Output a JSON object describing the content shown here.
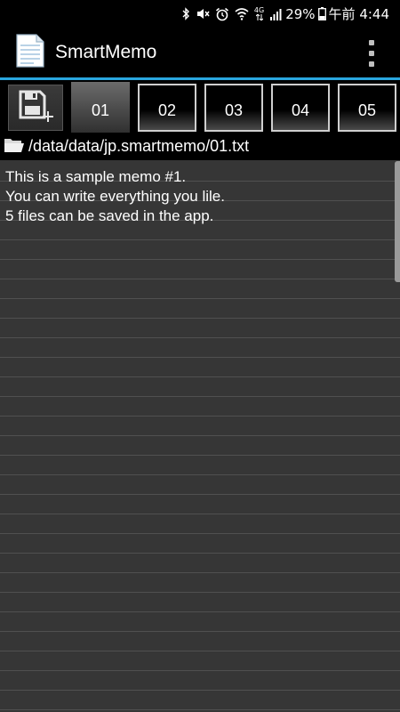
{
  "status_bar": {
    "icons": [
      "bluetooth-icon",
      "mute-icon",
      "alarm-icon",
      "wifi-icon",
      "lte-icon",
      "signal-icon"
    ],
    "network_label": "4G",
    "battery": "29%",
    "time": "午前 4:44"
  },
  "app_bar": {
    "title": "SmartMemo",
    "icon": "memo-document-icon",
    "menu_icon": "overflow-menu-icon"
  },
  "tabs": {
    "save_icon": "save-add-icon",
    "items": [
      {
        "label": "01",
        "active": true
      },
      {
        "label": "02",
        "active": false
      },
      {
        "label": "03",
        "active": false
      },
      {
        "label": "04",
        "active": false
      },
      {
        "label": "05",
        "active": false
      }
    ]
  },
  "path_bar": {
    "icon": "folder-open-icon",
    "path": "/data/data/jp.smartmemo/01.txt"
  },
  "memo": {
    "text": "This is a sample memo #1.\nYou can write everything you lile.\n5 files can be saved in the app."
  },
  "colors": {
    "accent": "#2aa7e0",
    "memo_background": "#363636",
    "rule_line": "#505050"
  }
}
